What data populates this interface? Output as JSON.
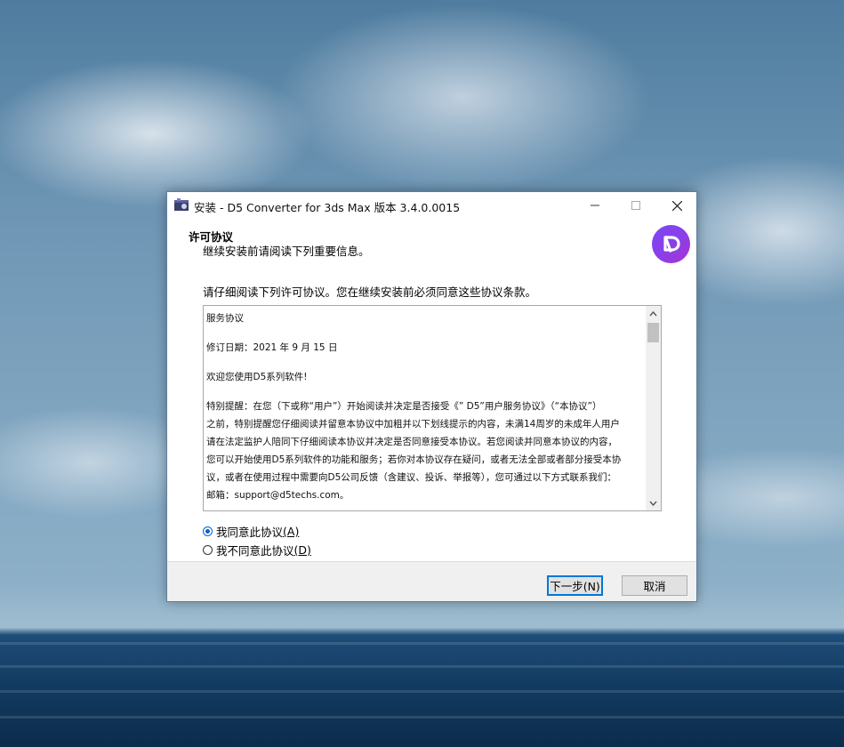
{
  "window": {
    "title": "安装 - D5 Converter for 3ds Max 版本 3.4.0.0015",
    "app_icon": "installer-box-icon",
    "controls": {
      "minimize": "minimize-icon",
      "maximize": "maximize-icon",
      "close": "close-icon"
    }
  },
  "header": {
    "title": "许可协议",
    "subtitle": "继续安装前请阅读下列重要信息。",
    "logo": "d5-logo-icon",
    "logo_color": "#8a3fe8"
  },
  "instruction": "请仔细阅读下列许可协议。您在继续安装前必须同意这些协议条款。",
  "license_text": {
    "lines": [
      "服务协议",
      "修订日期：2021 年 9 月 15 日",
      "欢迎您使用D5系列软件!",
      "特别提醒：在您（下或称“用户”）开始阅读并决定是否接受《” D5”用户服务协议》（“本协议”）",
      "之前，特别提醒您仔细阅读并留意本协议中加粗并以下划线提示的内容，未满14周岁的未成年人用户",
      "请在法定监护人陪同下仔细阅读本协议并决定是否同意接受本协议。若您阅读并同意本协议的内容，",
      "您可以开始使用D5系列软件的功能和服务；若你对本协议存在疑问，或者无法全部或者部分接受本协",
      "议，或者在使用过程中需要向D5公司反馈（含建议、投诉、举报等），您可通过以下方式联系我们：",
      "邮箱：support@d5techs.com。"
    ]
  },
  "radios": [
    {
      "label": "我同意此协议",
      "key": "(A)",
      "checked": true
    },
    {
      "label": "我不同意此协议",
      "key": "(D)",
      "checked": false
    }
  ],
  "buttons": {
    "next": "下一步(N)",
    "cancel": "取消"
  }
}
